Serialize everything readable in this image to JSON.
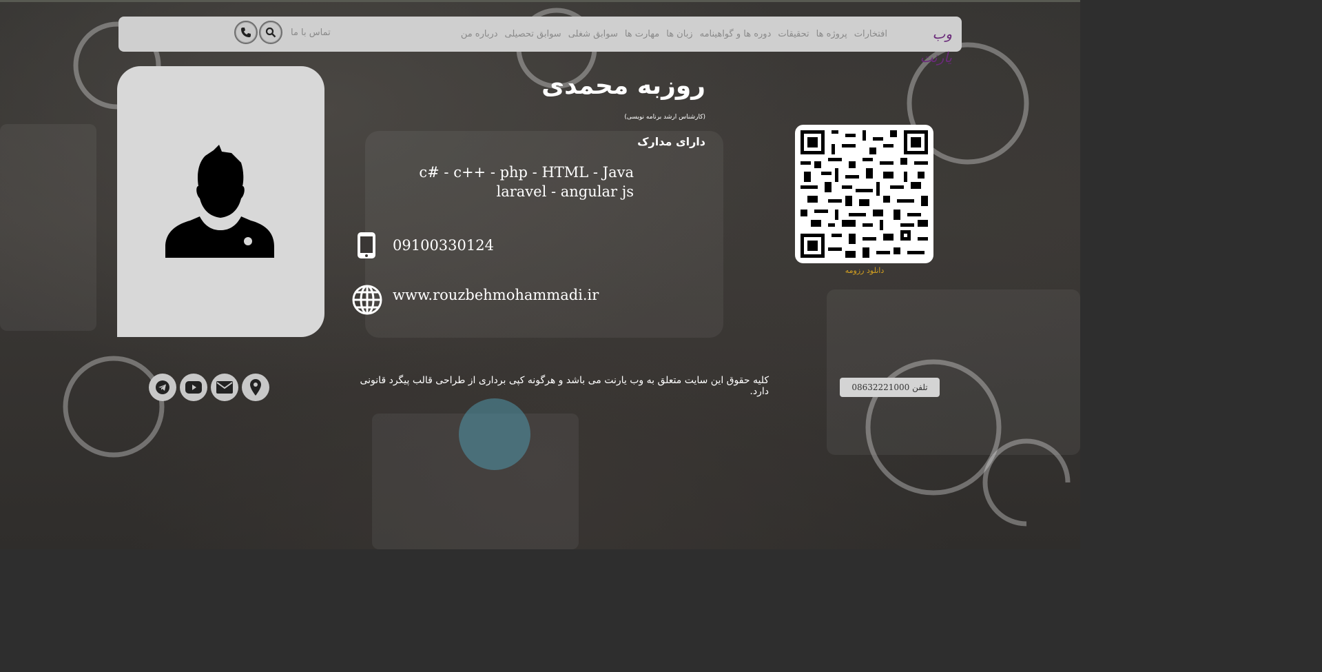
{
  "header": {
    "logo_text": "وب یارنت",
    "nav": [
      {
        "label": "درباره من"
      },
      {
        "label": "سوابق تحصیلی"
      },
      {
        "label": "سوابق شغلی"
      },
      {
        "label": "مهارت ها"
      },
      {
        "label": "زبان ها"
      },
      {
        "label": "دوره ها و گواهینامه"
      },
      {
        "label": "تحقیقات"
      },
      {
        "label": "پروژه ها"
      },
      {
        "label": "افتخارات"
      }
    ],
    "contact_label": "تماس با ما",
    "icons": {
      "search": "search-icon",
      "phone": "phone-icon"
    }
  },
  "profile": {
    "name": "روزبه محمدی",
    "subtitle": "(کارشناس ارشد برنامه نویسی)",
    "certs_label": "دارای مدارک",
    "skills_line1": "c# - c++ - php - HTML - Java",
    "skills_line2": "laravel - angular js",
    "phone": "09100330124",
    "website": "www.rouzbehmohammadi.ir",
    "avatar_icon": "user-silhouette-icon"
  },
  "qr": {
    "download_label": "دانلود رزومه",
    "icon": "qr-code-icon"
  },
  "footer": {
    "copyright": "کلیه حقوق این سایت متعلق به وب یارنت می باشد و هرگونه کپی برداری از طراحی قالب پیگرد قانونی دارد.",
    "tel_label": "تلفن 08632221000",
    "socials": [
      "location-icon",
      "email-icon",
      "youtube-icon",
      "telegram-icon"
    ]
  },
  "colors": {
    "navbar_bg": "#cfcfcf",
    "logo": "#6a2a7a",
    "download_link": "#d4a020",
    "card_bg": "#d8d8d8"
  }
}
